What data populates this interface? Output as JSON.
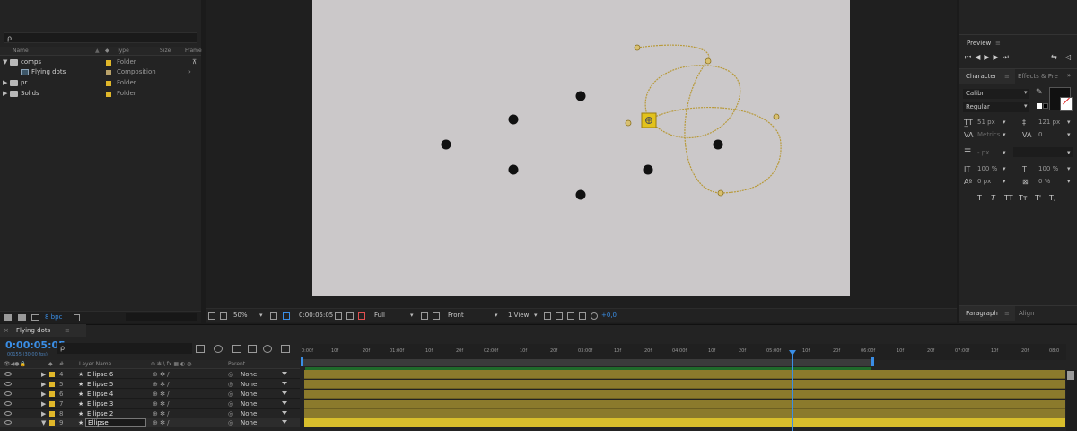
{
  "project": {
    "search_icon": "search-icon",
    "search_text": "ρ.",
    "columns": [
      "Name",
      "Type",
      "Size",
      "Frame"
    ],
    "items": [
      {
        "name": "comps",
        "type": "Folder",
        "expanded": true
      },
      {
        "name": "Flying dots",
        "type": "Composition"
      },
      {
        "name": "pr",
        "type": "Folder"
      },
      {
        "name": "Solids",
        "type": "Folder"
      }
    ],
    "bpc": "8 bpc"
  },
  "viewer": {
    "zoom": "50%",
    "timecode": "0:00:05:05",
    "resolution": "Full",
    "view": "Front",
    "views": "1 View",
    "exposure": "+0,0"
  },
  "character": {
    "preview_tab": "Preview",
    "character_tab": "Character",
    "effects_tab": "Effects & Pre",
    "font": "Calibri",
    "style": "Regular",
    "size": "51 px",
    "leading": "121 px",
    "kerning": "Metrics",
    "tracking": "0",
    "stroke": "- px",
    "vscale": "100 %",
    "hscale": "100 %",
    "baseline": "0 px",
    "tsume": "0 %",
    "styles": [
      "T",
      "T",
      "TT",
      "Tт",
      "T'",
      "T,"
    ],
    "paragraph_tab": "Paragraph",
    "align_tab": "Align",
    "accent": "#3a8ee6"
  },
  "timeline": {
    "tab": "Flying dots",
    "timecode": "0:00:05:05",
    "fps": "00155 (30.00 fps)",
    "search_text": "ρ.",
    "layer_header": "Layer Name",
    "parent_header": "Parent",
    "layers": [
      {
        "num": "4",
        "name": "Ellipse 6",
        "parent": "None"
      },
      {
        "num": "5",
        "name": "Ellipse 5",
        "parent": "None"
      },
      {
        "num": "6",
        "name": "Ellipse 4",
        "parent": "None"
      },
      {
        "num": "7",
        "name": "Ellipse 3",
        "parent": "None"
      },
      {
        "num": "8",
        "name": "Ellipse 2",
        "parent": "None"
      },
      {
        "num": "9",
        "name": "Ellipse",
        "parent": "None"
      }
    ],
    "ruler": [
      "0:00f",
      "10f",
      "20f",
      "01:00f",
      "10f",
      "20f",
      "02:00f",
      "10f",
      "20f",
      "03:00f",
      "10f",
      "20f",
      "04:00f",
      "10f",
      "20f",
      "05:00f",
      "10f",
      "20f",
      "06:00f",
      "10f",
      "20f",
      "07:00f",
      "10f",
      "20f",
      "08:0"
    ],
    "layer_color": "#e0b72a"
  }
}
